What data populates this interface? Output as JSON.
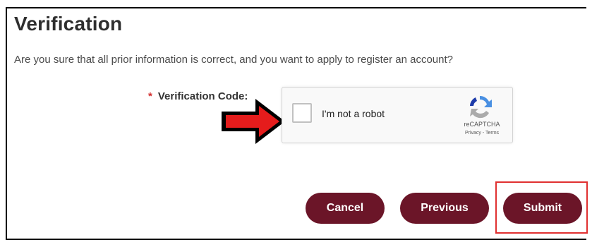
{
  "header": {
    "title": "Verification",
    "description": "Are you sure that all prior information is correct, and you want to apply to register an account?"
  },
  "form": {
    "required_marker": "*",
    "verification_label": "Verification Code:"
  },
  "recaptcha": {
    "checkbox_label": "I'm not a robot",
    "brand": "reCAPTCHA",
    "links": "Privacy - Terms",
    "checked": false
  },
  "buttons": {
    "cancel": "Cancel",
    "previous": "Previous",
    "submit": "Submit"
  },
  "colors": {
    "button_bg": "#6b1528",
    "annotation_red": "#e03030"
  }
}
